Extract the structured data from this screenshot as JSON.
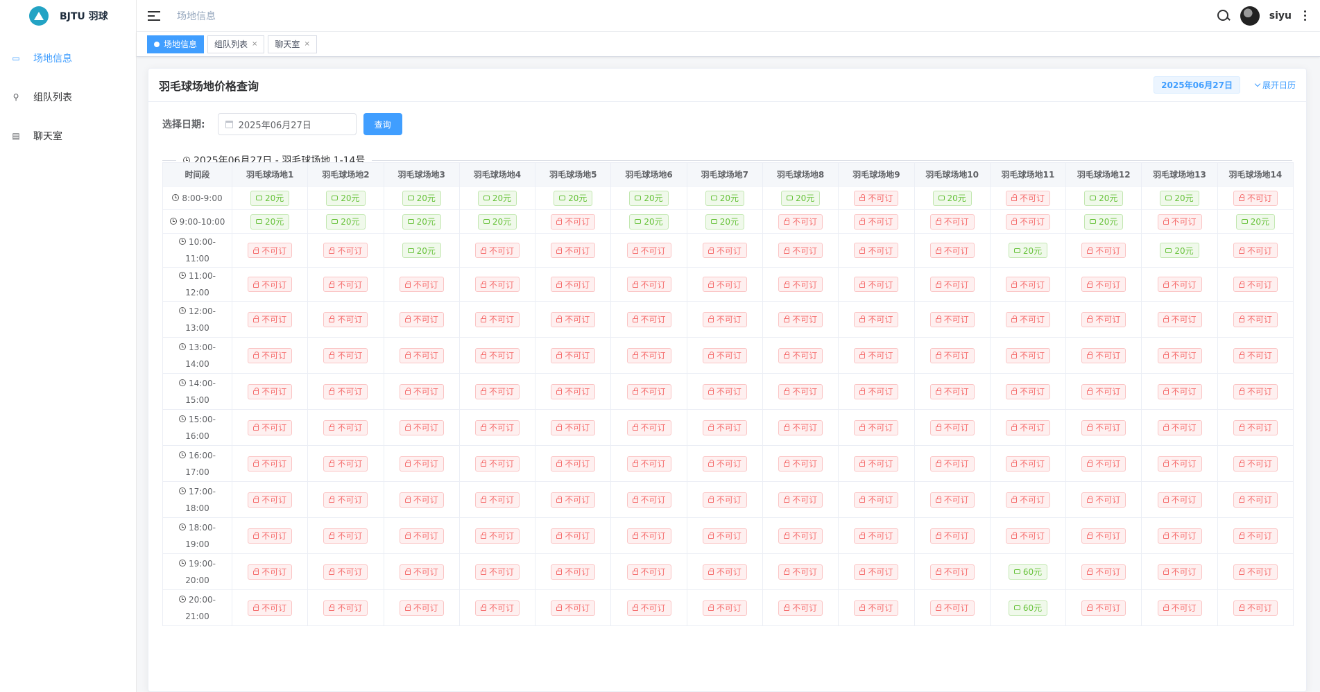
{
  "app": {
    "title": "BJTU 羽球"
  },
  "sidebar": {
    "items": [
      {
        "label": "场地信息",
        "icon": "venue-icon",
        "active": true
      },
      {
        "label": "组队列表",
        "icon": "user-icon",
        "active": false
      },
      {
        "label": "聊天室",
        "icon": "chat-icon",
        "active": false
      }
    ]
  },
  "navbar": {
    "breadcrumb": "场地信息",
    "username": "siyu"
  },
  "tags": [
    {
      "label": "场地信息",
      "active": true
    },
    {
      "label": "组队列表",
      "active": false
    },
    {
      "label": "聊天室",
      "active": false
    }
  ],
  "card": {
    "title": "羽毛球场地价格查询",
    "date_badge": "2025年06月27日",
    "expand_label": "展开日历",
    "query_label": "选择日期:",
    "date_value": "2025年06月27日",
    "query_button": "查询",
    "section_title": "2025年06月27日 - 羽毛球场地 1-14号"
  },
  "colors": {
    "accent": "#409eff",
    "available": "#67c23a",
    "unavailable": "#f56c6c"
  },
  "table": {
    "time_header": "时间段",
    "unavailable_label": "不可订",
    "courts": [
      "羽毛球场地1",
      "羽毛球场地2",
      "羽毛球场地3",
      "羽毛球场地4",
      "羽毛球场地5",
      "羽毛球场地6",
      "羽毛球场地7",
      "羽毛球场地8",
      "羽毛球场地9",
      "羽毛球场地10",
      "羽毛球场地11",
      "羽毛球场地12",
      "羽毛球场地13",
      "羽毛球场地14"
    ],
    "rows": [
      {
        "time": "8:00-9:00",
        "cells": [
          "20元",
          "20元",
          "20元",
          "20元",
          "20元",
          "20元",
          "20元",
          "20元",
          null,
          "20元",
          null,
          "20元",
          "20元",
          null
        ]
      },
      {
        "time": "9:00-10:00",
        "cells": [
          "20元",
          "20元",
          "20元",
          "20元",
          null,
          "20元",
          "20元",
          null,
          null,
          null,
          null,
          "20元",
          null,
          "20元"
        ]
      },
      {
        "time": "10:00-11:00",
        "cells": [
          null,
          null,
          "20元",
          null,
          null,
          null,
          null,
          null,
          null,
          null,
          "20元",
          null,
          "20元",
          null
        ]
      },
      {
        "time": "11:00-12:00",
        "cells": [
          null,
          null,
          null,
          null,
          null,
          null,
          null,
          null,
          null,
          null,
          null,
          null,
          null,
          null
        ]
      },
      {
        "time": "12:00-13:00",
        "cells": [
          null,
          null,
          null,
          null,
          null,
          null,
          null,
          null,
          null,
          null,
          null,
          null,
          null,
          null
        ]
      },
      {
        "time": "13:00-14:00",
        "cells": [
          null,
          null,
          null,
          null,
          null,
          null,
          null,
          null,
          null,
          null,
          null,
          null,
          null,
          null
        ]
      },
      {
        "time": "14:00-15:00",
        "cells": [
          null,
          null,
          null,
          null,
          null,
          null,
          null,
          null,
          null,
          null,
          null,
          null,
          null,
          null
        ]
      },
      {
        "time": "15:00-16:00",
        "cells": [
          null,
          null,
          null,
          null,
          null,
          null,
          null,
          null,
          null,
          null,
          null,
          null,
          null,
          null
        ]
      },
      {
        "time": "16:00-17:00",
        "cells": [
          null,
          null,
          null,
          null,
          null,
          null,
          null,
          null,
          null,
          null,
          null,
          null,
          null,
          null
        ]
      },
      {
        "time": "17:00-18:00",
        "cells": [
          null,
          null,
          null,
          null,
          null,
          null,
          null,
          null,
          null,
          null,
          null,
          null,
          null,
          null
        ]
      },
      {
        "time": "18:00-19:00",
        "cells": [
          null,
          null,
          null,
          null,
          null,
          null,
          null,
          null,
          null,
          null,
          null,
          null,
          null,
          null
        ]
      },
      {
        "time": "19:00-20:00",
        "cells": [
          null,
          null,
          null,
          null,
          null,
          null,
          null,
          null,
          null,
          null,
          "60元",
          null,
          null,
          null
        ]
      },
      {
        "time": "20:00-21:00",
        "cells": [
          null,
          null,
          null,
          null,
          null,
          null,
          null,
          null,
          null,
          null,
          "60元",
          null,
          null,
          null
        ]
      }
    ]
  }
}
